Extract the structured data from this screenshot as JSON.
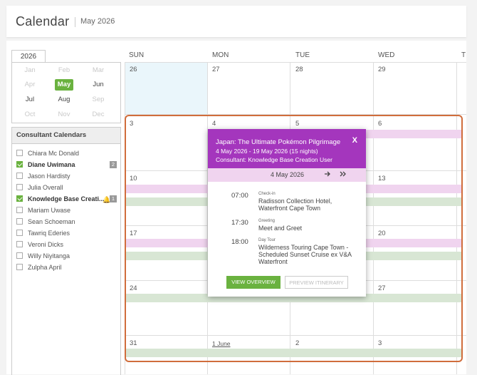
{
  "header": {
    "title": "Calendar",
    "subtitle": "May 2026"
  },
  "year_tab": "2026",
  "months": [
    {
      "label": "Jan",
      "state": "dim"
    },
    {
      "label": "Feb",
      "state": "dim"
    },
    {
      "label": "Mar",
      "state": "dim"
    },
    {
      "label": "Apr",
      "state": "dim"
    },
    {
      "label": "May",
      "state": "sel"
    },
    {
      "label": "Jun",
      "state": "norm"
    },
    {
      "label": "Jul",
      "state": "norm"
    },
    {
      "label": "Aug",
      "state": "norm"
    },
    {
      "label": "Sep",
      "state": "dim"
    },
    {
      "label": "Oct",
      "state": "dim"
    },
    {
      "label": "Nov",
      "state": "dim"
    },
    {
      "label": "Dec",
      "state": "dim"
    }
  ],
  "consultants": {
    "heading": "Consultant Calendars",
    "items": [
      {
        "label": "Chiara Mc Donald",
        "checked": false,
        "bold": false
      },
      {
        "label": "Diane Uwimana",
        "checked": true,
        "bold": true,
        "badge": "2"
      },
      {
        "label": "Jason Hardisty",
        "checked": false,
        "bold": false
      },
      {
        "label": "Julia Overall",
        "checked": false,
        "bold": false
      },
      {
        "label": "Knowledge Base Creati...",
        "checked": true,
        "bold": true,
        "badge": "1",
        "bell": true
      },
      {
        "label": "Mariam Uwase",
        "checked": false,
        "bold": false
      },
      {
        "label": "Sean Schoeman",
        "checked": false,
        "bold": false
      },
      {
        "label": "Tawriq Ederies",
        "checked": false,
        "bold": false
      },
      {
        "label": "Veroni Dicks",
        "checked": false,
        "bold": false
      },
      {
        "label": "Willy Niyitanga",
        "checked": false,
        "bold": false
      },
      {
        "label": "Zulpha April",
        "checked": false,
        "bold": false
      }
    ]
  },
  "weekdays": [
    "SUN",
    "MON",
    "TUE",
    "WED",
    "T"
  ],
  "weeks": [
    [
      "26",
      "27",
      "28",
      "29"
    ],
    [
      "3",
      "4",
      "5",
      "6"
    ],
    [
      "10",
      "",
      "",
      "13"
    ],
    [
      "17",
      "",
      "",
      "20"
    ],
    [
      "24",
      "",
      "",
      "27"
    ],
    [
      "31",
      "1 June",
      "2",
      "3"
    ]
  ],
  "popup": {
    "title": "Japan: The Ultimate Pokémon Pilgrimage",
    "dates": "4 May 2026 - 19 May 2026 (15 nights)",
    "consultant": "Consultant: Knowledge Base Creation User",
    "close": "X",
    "nav_date": "4 May 2026",
    "next_icon": "arrow-right-icon",
    "skip_icon": "double-chevron-right-icon",
    "items": [
      {
        "time": "07:00",
        "type": "Check-in",
        "desc": "Radisson Collection Hotel, Waterfront Cape Town"
      },
      {
        "time": "17:30",
        "type": "Greeting",
        "desc": "Meet and Greet"
      },
      {
        "time": "18:00",
        "type": "Day Tour",
        "desc": "Wilderness Touring Cape Town - Scheduled Sunset Cruise ex V&A Waterfront"
      }
    ],
    "btn_overview": "VIEW OVERVIEW",
    "btn_preview": "PREVIEW ITINERARY"
  },
  "colors": {
    "accent_green": "#6ab23f",
    "popup_purple": "#a436bd",
    "event_pink": "#f0d4ef",
    "event_green": "#d8e6d4",
    "selection_frame": "#d06d3c"
  }
}
